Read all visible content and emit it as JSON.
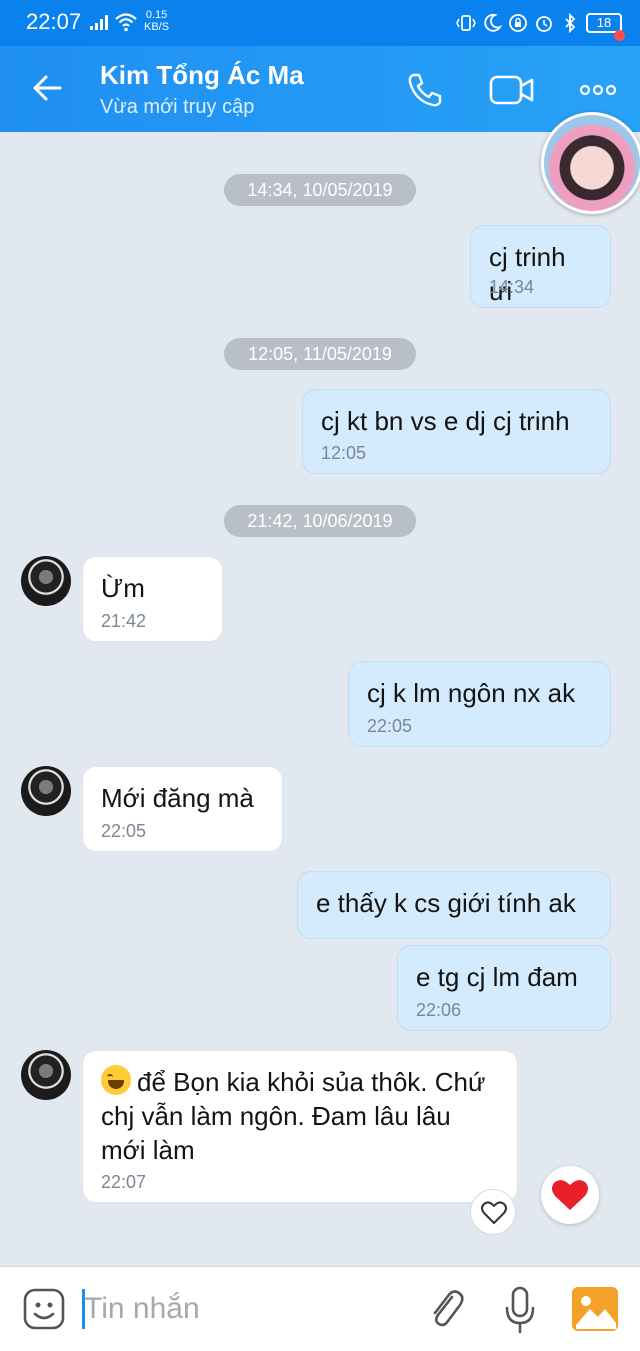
{
  "status_bar": {
    "time": "22:07",
    "speed_value": "0.15",
    "speed_unit": "KB/S",
    "battery": "18"
  },
  "header": {
    "contact_name": "Kim Tổng Ác Ma",
    "status": "Vừa mới truy cập"
  },
  "messages": [
    {
      "date": "14:34, 10/05/2019"
    },
    {
      "text": "cj trinh ưi",
      "time": "14:34"
    },
    {
      "date": "12:05, 11/05/2019"
    },
    {
      "text": "cj kt bn vs e dj cj trinh",
      "time": "12:05"
    },
    {
      "date": "21:42, 10/06/2019"
    },
    {
      "text": "Ừm",
      "time": "21:42"
    },
    {
      "text": "cj k lm ngôn nx ak",
      "time": "22:05"
    },
    {
      "text": "Mới đăng mà",
      "time": "22:05"
    },
    {
      "text": "e thấy k cs giới tính ak"
    },
    {
      "text": "e tg cj lm đam",
      "time": "22:06"
    },
    {
      "text": "để Bọn kia khỏi sủa thôk. Chứ chj vẫn làm ngôn. Đam lâu lâu mới làm",
      "emoji": "face-with-tears-of-joy",
      "time": "22:07"
    }
  ],
  "composer": {
    "placeholder": "Tin nhắn"
  },
  "colors": {
    "header": "#1f8ff3",
    "my_bubble": "#d4ebfd",
    "their_bubble": "#ffffff",
    "background": "#e2e8f0",
    "reaction_heart": "#e8202a"
  }
}
